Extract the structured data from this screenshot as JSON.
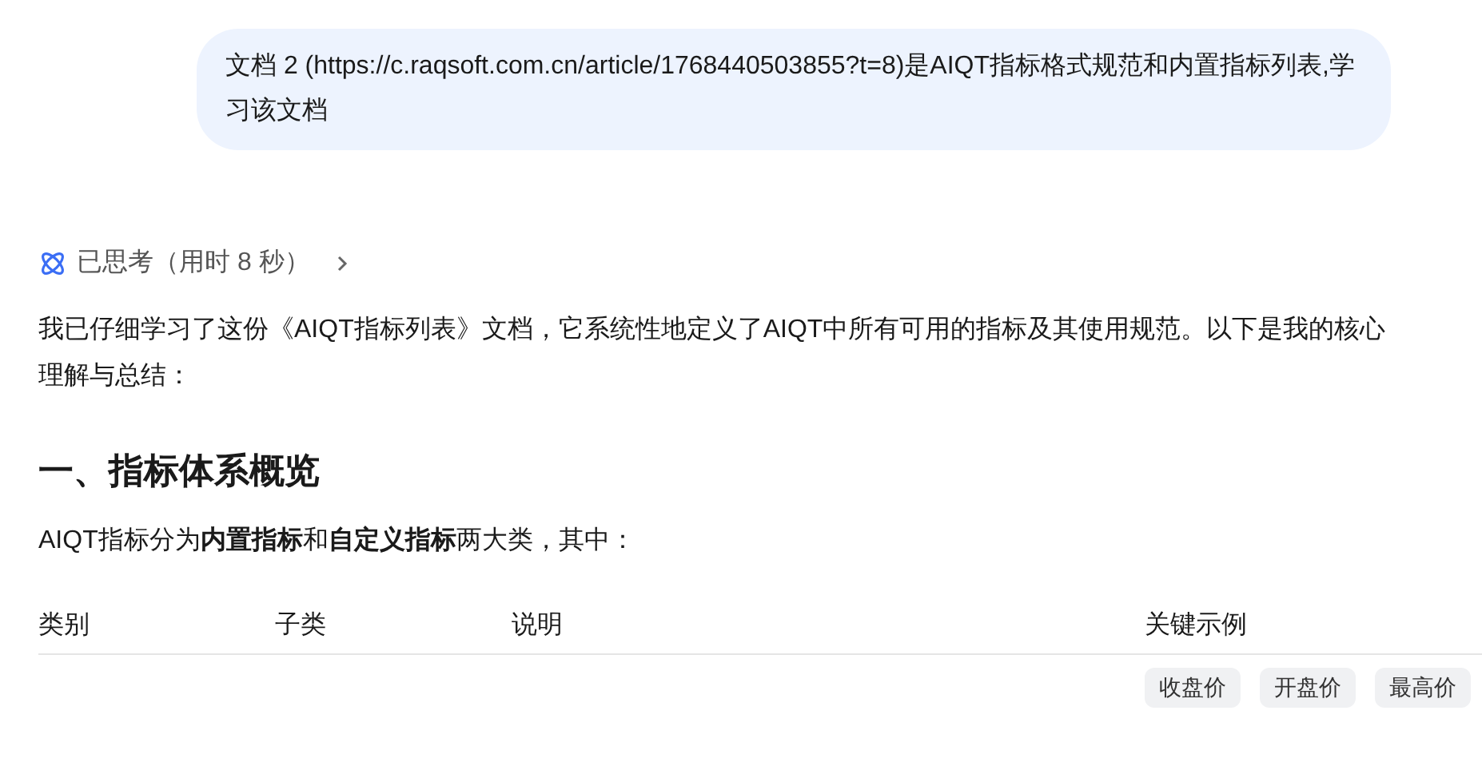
{
  "user_message": "文档 2 (https://c.raqsoft.com.cn/article/1768440503855?t=8)是AIQT指标格式规范和内置指标列表,学习该文档",
  "thinking": {
    "label": "已思考（用时 8 秒）",
    "expanded": false
  },
  "answer": {
    "intro": "我已仔细学习了这份《AIQT指标列表》文档，它系统性地定义了AIQT中所有可用的指标及其使用规范。以下是我的核心理解与总结：",
    "heading": "一、指标体系概览",
    "paragraph": "AIQT指标分为**内置指标**和**自定义指标**两大类，其中：",
    "table": {
      "columns": [
        "类别",
        "子类",
        "说明",
        "关键示例"
      ],
      "rows": [
        {
          "cells": [
            "",
            "",
            ""
          ],
          "tags": [
            "收盘价",
            "开盘价",
            "最高价"
          ]
        }
      ]
    }
  }
}
